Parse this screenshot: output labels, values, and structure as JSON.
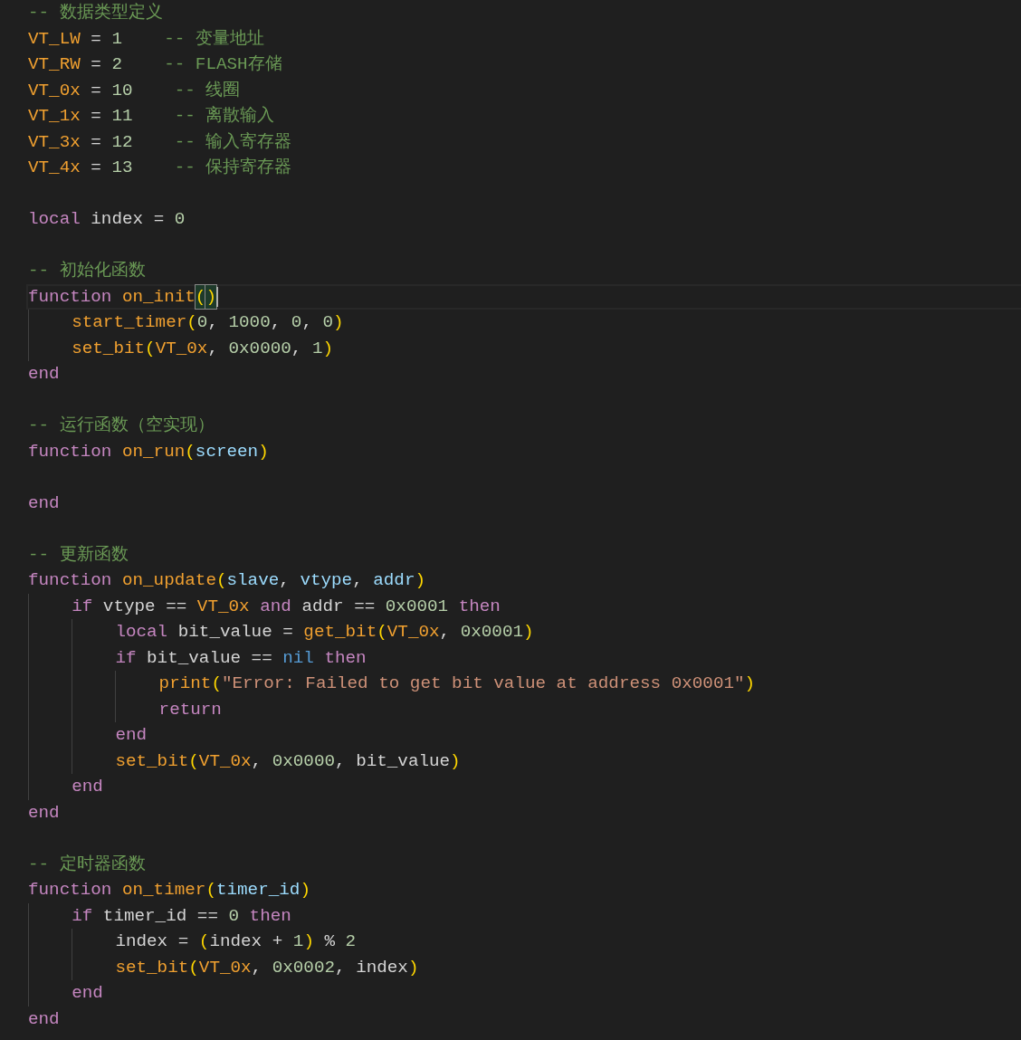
{
  "editor": {
    "lines": [
      {
        "kind": "code",
        "tokens": [
          {
            "text": "-- 数据类型定义",
            "kind": "comment"
          }
        ]
      },
      {
        "kind": "code",
        "tokens": [
          {
            "text": "VT_LW",
            "kind": "constant"
          },
          {
            "text": " = ",
            "kind": "op"
          },
          {
            "text": "1",
            "kind": "number"
          },
          {
            "text": "    -- 变量地址",
            "kind": "comment"
          }
        ]
      },
      {
        "kind": "code",
        "tokens": [
          {
            "text": "VT_RW",
            "kind": "constant"
          },
          {
            "text": " = ",
            "kind": "op"
          },
          {
            "text": "2",
            "kind": "number"
          },
          {
            "text": "    -- FLASH存储",
            "kind": "comment"
          }
        ]
      },
      {
        "kind": "code",
        "tokens": [
          {
            "text": "VT_0x",
            "kind": "constant"
          },
          {
            "text": " = ",
            "kind": "op"
          },
          {
            "text": "10",
            "kind": "number"
          },
          {
            "text": "    -- 线圈",
            "kind": "comment"
          }
        ]
      },
      {
        "kind": "code",
        "tokens": [
          {
            "text": "VT_1x",
            "kind": "constant"
          },
          {
            "text": " = ",
            "kind": "op"
          },
          {
            "text": "11",
            "kind": "number"
          },
          {
            "text": "    -- 离散输入",
            "kind": "comment"
          }
        ]
      },
      {
        "kind": "code",
        "tokens": [
          {
            "text": "VT_3x",
            "kind": "constant"
          },
          {
            "text": " = ",
            "kind": "op"
          },
          {
            "text": "12",
            "kind": "number"
          },
          {
            "text": "    -- 输入寄存器",
            "kind": "comment"
          }
        ]
      },
      {
        "kind": "code",
        "tokens": [
          {
            "text": "VT_4x",
            "kind": "constant"
          },
          {
            "text": " = ",
            "kind": "op"
          },
          {
            "text": "13",
            "kind": "number"
          },
          {
            "text": "    -- 保持寄存器",
            "kind": "comment"
          }
        ]
      },
      {
        "kind": "blank"
      },
      {
        "kind": "code",
        "tokens": [
          {
            "text": "local",
            "kind": "keyword"
          },
          {
            "text": " index = ",
            "kind": "op"
          },
          {
            "text": "0",
            "kind": "number"
          }
        ]
      },
      {
        "kind": "blank"
      },
      {
        "kind": "code",
        "tokens": [
          {
            "text": "-- 初始化函数",
            "kind": "comment"
          }
        ]
      },
      {
        "kind": "code",
        "current": true,
        "tokens": [
          {
            "text": "function ",
            "kind": "keyword"
          },
          {
            "text": "on_init",
            "kind": "function"
          },
          {
            "text": "(",
            "kind": "bracket",
            "matched": true
          },
          {
            "text": ")",
            "kind": "bracket",
            "matched": true
          }
        ],
        "children": [
          {
            "kind": "code",
            "tokens": [
              {
                "text": "start_timer",
                "kind": "function"
              },
              {
                "text": "(",
                "kind": "bracket"
              },
              {
                "text": "0",
                "kind": "number"
              },
              {
                "text": ", ",
                "kind": "op"
              },
              {
                "text": "1000",
                "kind": "number"
              },
              {
                "text": ", ",
                "kind": "op"
              },
              {
                "text": "0",
                "kind": "number"
              },
              {
                "text": ", ",
                "kind": "op"
              },
              {
                "text": "0",
                "kind": "number"
              },
              {
                "text": ")",
                "kind": "bracket"
              }
            ]
          },
          {
            "kind": "code",
            "tokens": [
              {
                "text": "set_bit",
                "kind": "function"
              },
              {
                "text": "(",
                "kind": "bracket"
              },
              {
                "text": "VT_0x",
                "kind": "constant"
              },
              {
                "text": ", ",
                "kind": "op"
              },
              {
                "text": "0x0000",
                "kind": "number"
              },
              {
                "text": ", ",
                "kind": "op"
              },
              {
                "text": "1",
                "kind": "number"
              },
              {
                "text": ")",
                "kind": "bracket"
              }
            ]
          }
        ]
      },
      {
        "kind": "code",
        "tokens": [
          {
            "text": "end",
            "kind": "keyword"
          }
        ]
      },
      {
        "kind": "blank"
      },
      {
        "kind": "code",
        "tokens": [
          {
            "text": "-- 运行函数（空实现）",
            "kind": "comment"
          }
        ]
      },
      {
        "kind": "code",
        "tokens": [
          {
            "text": "function ",
            "kind": "keyword"
          },
          {
            "text": "on_run",
            "kind": "function"
          },
          {
            "text": "(",
            "kind": "bracket"
          },
          {
            "text": "screen",
            "kind": "param"
          },
          {
            "text": ")",
            "kind": "bracket"
          }
        ]
      },
      {
        "kind": "blank"
      },
      {
        "kind": "code",
        "tokens": [
          {
            "text": "end",
            "kind": "keyword"
          }
        ]
      },
      {
        "kind": "blank"
      },
      {
        "kind": "code",
        "tokens": [
          {
            "text": "-- 更新函数",
            "kind": "comment"
          }
        ]
      },
      {
        "kind": "code",
        "tokens": [
          {
            "text": "function ",
            "kind": "keyword"
          },
          {
            "text": "on_update",
            "kind": "function"
          },
          {
            "text": "(",
            "kind": "bracket"
          },
          {
            "text": "slave",
            "kind": "param"
          },
          {
            "text": ", ",
            "kind": "op"
          },
          {
            "text": "vtype",
            "kind": "param"
          },
          {
            "text": ", ",
            "kind": "op"
          },
          {
            "text": "addr",
            "kind": "param"
          },
          {
            "text": ")",
            "kind": "bracket"
          }
        ],
        "children": [
          {
            "kind": "code",
            "tokens": [
              {
                "text": "if",
                "kind": "keyword"
              },
              {
                "text": " vtype == ",
                "kind": "op"
              },
              {
                "text": "VT_0x",
                "kind": "constant"
              },
              {
                "text": " and",
                "kind": "keyword"
              },
              {
                "text": " addr == ",
                "kind": "op"
              },
              {
                "text": "0x0001",
                "kind": "number"
              },
              {
                "text": " then",
                "kind": "keyword"
              }
            ],
            "children": [
              {
                "kind": "code",
                "tokens": [
                  {
                    "text": "local",
                    "kind": "keyword"
                  },
                  {
                    "text": " bit_value = ",
                    "kind": "op"
                  },
                  {
                    "text": "get_bit",
                    "kind": "function"
                  },
                  {
                    "text": "(",
                    "kind": "bracket"
                  },
                  {
                    "text": "VT_0x",
                    "kind": "constant"
                  },
                  {
                    "text": ", ",
                    "kind": "op"
                  },
                  {
                    "text": "0x0001",
                    "kind": "number"
                  },
                  {
                    "text": ")",
                    "kind": "bracket"
                  }
                ]
              },
              {
                "kind": "code",
                "tokens": [
                  {
                    "text": "if",
                    "kind": "keyword"
                  },
                  {
                    "text": " bit_value == ",
                    "kind": "op"
                  },
                  {
                    "text": "nil",
                    "kind": "builtin"
                  },
                  {
                    "text": " then",
                    "kind": "keyword"
                  }
                ],
                "children": [
                  {
                    "kind": "code",
                    "tokens": [
                      {
                        "text": "print",
                        "kind": "function"
                      },
                      {
                        "text": "(",
                        "kind": "bracket"
                      },
                      {
                        "text": "\"Error: Failed to get bit value at address 0x0001\"",
                        "kind": "string"
                      },
                      {
                        "text": ")",
                        "kind": "bracket"
                      }
                    ]
                  },
                  {
                    "kind": "code",
                    "tokens": [
                      {
                        "text": "return",
                        "kind": "keyword"
                      }
                    ]
                  }
                ]
              },
              {
                "kind": "code",
                "tokens": [
                  {
                    "text": "end",
                    "kind": "keyword"
                  }
                ]
              },
              {
                "kind": "code",
                "tokens": [
                  {
                    "text": "set_bit",
                    "kind": "function"
                  },
                  {
                    "text": "(",
                    "kind": "bracket"
                  },
                  {
                    "text": "VT_0x",
                    "kind": "constant"
                  },
                  {
                    "text": ", ",
                    "kind": "op"
                  },
                  {
                    "text": "0x0000",
                    "kind": "number"
                  },
                  {
                    "text": ", bit_value",
                    "kind": "op"
                  },
                  {
                    "text": ")",
                    "kind": "bracket"
                  }
                ]
              }
            ]
          },
          {
            "kind": "code",
            "tokens": [
              {
                "text": "end",
                "kind": "keyword"
              }
            ]
          }
        ]
      },
      {
        "kind": "code",
        "tokens": [
          {
            "text": "end",
            "kind": "keyword"
          }
        ]
      },
      {
        "kind": "blank"
      },
      {
        "kind": "code",
        "tokens": [
          {
            "text": "-- 定时器函数",
            "kind": "comment"
          }
        ]
      },
      {
        "kind": "code",
        "tokens": [
          {
            "text": "function ",
            "kind": "keyword"
          },
          {
            "text": "on_timer",
            "kind": "function"
          },
          {
            "text": "(",
            "kind": "bracket"
          },
          {
            "text": "timer_id",
            "kind": "param"
          },
          {
            "text": ")",
            "kind": "bracket"
          }
        ],
        "children": [
          {
            "kind": "code",
            "tokens": [
              {
                "text": "if",
                "kind": "keyword"
              },
              {
                "text": " timer_id == ",
                "kind": "op"
              },
              {
                "text": "0",
                "kind": "number"
              },
              {
                "text": " then",
                "kind": "keyword"
              }
            ],
            "children": [
              {
                "kind": "code",
                "tokens": [
                  {
                    "text": "index = ",
                    "kind": "op"
                  },
                  {
                    "text": "(",
                    "kind": "bracket"
                  },
                  {
                    "text": "index + ",
                    "kind": "op"
                  },
                  {
                    "text": "1",
                    "kind": "number"
                  },
                  {
                    "text": ")",
                    "kind": "bracket"
                  },
                  {
                    "text": " % ",
                    "kind": "op"
                  },
                  {
                    "text": "2",
                    "kind": "number"
                  }
                ]
              },
              {
                "kind": "code",
                "tokens": [
                  {
                    "text": "set_bit",
                    "kind": "function"
                  },
                  {
                    "text": "(",
                    "kind": "bracket"
                  },
                  {
                    "text": "VT_0x",
                    "kind": "constant"
                  },
                  {
                    "text": ", ",
                    "kind": "op"
                  },
                  {
                    "text": "0x0002",
                    "kind": "number"
                  },
                  {
                    "text": ", index",
                    "kind": "op"
                  },
                  {
                    "text": ")",
                    "kind": "bracket"
                  }
                ]
              }
            ]
          },
          {
            "kind": "code",
            "tokens": [
              {
                "text": "end",
                "kind": "keyword"
              }
            ]
          }
        ]
      },
      {
        "kind": "code",
        "tokens": [
          {
            "text": "end",
            "kind": "keyword"
          }
        ]
      }
    ]
  }
}
